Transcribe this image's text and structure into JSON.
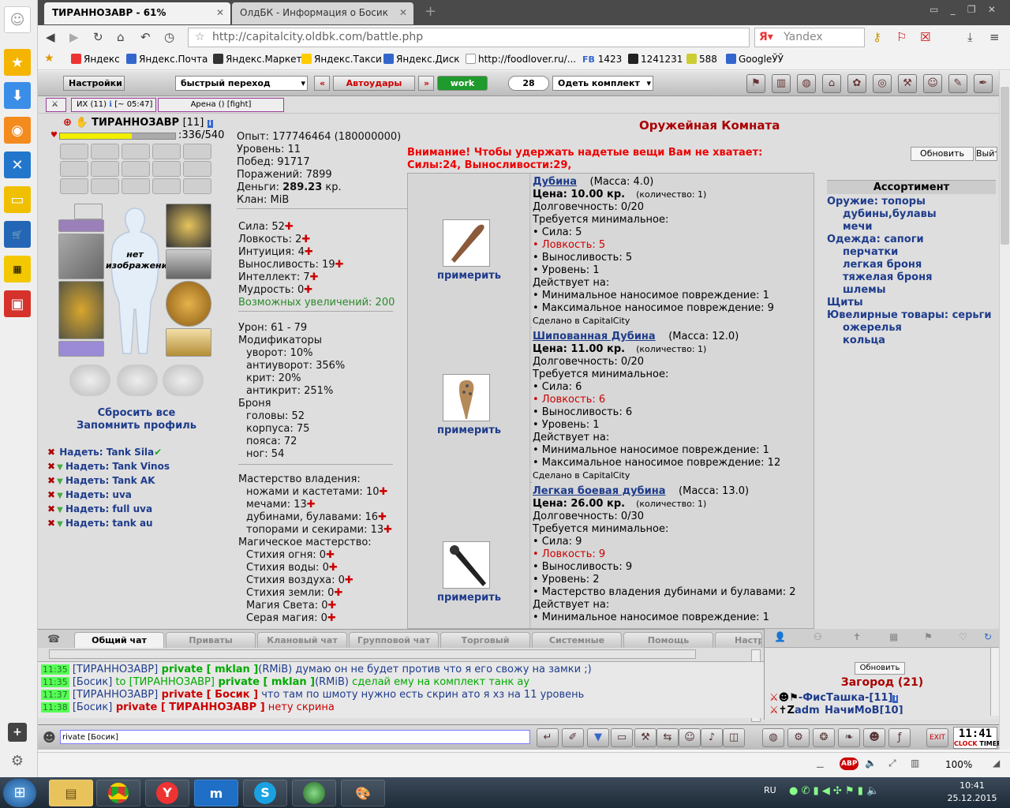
{
  "browser": {
    "tabs": [
      {
        "label": "ТИРАННОЗАВР - 61%",
        "active": true
      },
      {
        "label": "ОлдБК - Информация о Босик",
        "active": false
      }
    ],
    "url": "http://capitalcity.oldbk.com/battle.php",
    "search_placeholder": "Yandex",
    "bookmarks": [
      {
        "label": "Яндекс",
        "color": "#e33"
      },
      {
        "label": "Яндекс.Почта",
        "color": "#36c"
      },
      {
        "label": "Яндекс.Маркет",
        "color": "#333"
      },
      {
        "label": "Яндекс.Такси",
        "color": "#fc0"
      },
      {
        "label": "Яндекс.Диск",
        "color": "#36c"
      },
      {
        "label": "http://foodlover.ru/...",
        "color": "#bbb"
      },
      {
        "label": "1423",
        "color": "#36c",
        "icon_text": "FB"
      },
      {
        "label": "1241231",
        "color": "#222"
      },
      {
        "label": "588",
        "color": "#cc3"
      },
      {
        "label": "GoogleЎЎ",
        "color": "#36c"
      }
    ],
    "zoom": "100%"
  },
  "game_top": {
    "settings": "Настройки",
    "quick_nav": "быстрый переход",
    "prev": "«",
    "autohits": "Автоудары",
    "next": "»",
    "work": "work",
    "count": "28",
    "dress_set": "Одеть комплект"
  },
  "status": {
    "ix": "ИХ (11)",
    "ix_time": "[~ 05:47]",
    "arena": "Арена () [fight]"
  },
  "character": {
    "name": "ТИРАННОЗАВР",
    "level": "[11]",
    "hp": ":336/540",
    "hp_fraction": 0.62,
    "no_image": "нет изображения",
    "reset_all": "Сбросить все",
    "remember_profile": "Запомнить профиль",
    "sets": [
      "Надеть: Tank Sila",
      "Надеть: Tank Vinos",
      "Надеть: Tank AK",
      "Надеть: uva",
      "Надеть: full uva",
      "Надеть: tank au"
    ]
  },
  "info": {
    "exp": "Опыт: 177746464 (180000000)",
    "level": "Уровень: 11",
    "wins": "Побед: 91717",
    "losses": "Поражений: 7899",
    "money_label": "Деньги: ",
    "money_value": "289.23",
    "money_unit": " кр.",
    "clan": "Клан: MiB"
  },
  "stats": {
    "sila": "Сила: 52",
    "lovk": "Ловкость: 2",
    "intu": "Интуиция: 4",
    "vynos": "Выносливость: 19",
    "intel": "Интеллект: 7",
    "mudr": "Мудрость: 0",
    "possible": "Возможных увеличений: 200"
  },
  "combat": {
    "damage": "Урон: 61 - 79",
    "mods_title": "Модификаторы",
    "dodge": "уворот:  10%",
    "antidodge": "антиуворот:  356%",
    "crit": "крит:  20%",
    "anticrit": "антикрит:  251%",
    "armor_title": "Броня",
    "head": "головы:  52",
    "body": "корпуса:  75",
    "belt": "пояса:  72",
    "legs": "ног:  54"
  },
  "mastery": {
    "title": "Мастерство владения:",
    "knives": "ножами и кастетами: 10",
    "swords": "мечами: 13",
    "clubs": "дубинами, булавами: 16",
    "axes": "топорами и секирами: 13",
    "magic_title": "Магическое мастерство:",
    "fire": "Стихия огня: 0",
    "water": "Стихия воды: 0",
    "air": "Стихия воздуха: 0",
    "earth": "Стихия земли: 0",
    "light": "Магия Света: 0",
    "gray": "Серая магия: 0"
  },
  "armory": {
    "title": "Оружейная Комната",
    "warning": "Внимание! Чтобы удержать надетые вещи Вам не хватает:",
    "warning2": "Силы:24, Выносливости:29,",
    "refresh": "Обновить",
    "exit": "Выйти",
    "try_on": "примерить",
    "items": [
      {
        "name": "Дубина",
        "mass": "(Масса: 4.0)",
        "price": "Цена: 10.00 кр.",
        "qty": "(количество: 1)",
        "durability": "Долговечность: 0/20",
        "req_title": "Требуется минимальное:",
        "req": [
          "• Сила: 5",
          "• Ловкость: 5",
          "• Выносливость: 5",
          "• Уровень: 1"
        ],
        "req_red_index": 1,
        "acts_title": "Действует на:",
        "acts": [
          "• Минимальное наносимое повреждение: 1",
          "• Максимальное наносимое повреждение: 9"
        ],
        "made": "Сделано в CapitalCity"
      },
      {
        "name": "Шипованная Дубина",
        "mass": "(Масса: 12.0)",
        "price": "Цена: 11.00 кр.",
        "qty": "(количество: 1)",
        "durability": "Долговечность: 0/20",
        "req_title": "Требуется минимальное:",
        "req": [
          "• Сила: 6",
          "• Ловкость: 6",
          "• Выносливость: 6",
          "• Уровень: 1"
        ],
        "req_red_index": 1,
        "acts_title": "Действует на:",
        "acts": [
          "• Минимальное наносимое повреждение: 1",
          "• Максимальное наносимое повреждение: 12"
        ],
        "made": "Сделано в CapitalCity"
      },
      {
        "name": "Легкая боевая дубина",
        "mass": "(Масса: 13.0)",
        "price": "Цена: 26.00 кр.",
        "qty": "(количество: 1)",
        "durability": "Долговечность: 0/30",
        "req_title": "Требуется минимальное:",
        "req": [
          "• Сила: 9",
          "• Ловкость: 9",
          "• Выносливость: 9",
          "• Уровень: 2",
          "• Мастерство владения дубинами и булавами: 2"
        ],
        "req_red_index": 1,
        "acts_title": "Действует на:",
        "acts": [
          "• Минимальное наносимое повреждение: 1"
        ],
        "made": ""
      }
    ]
  },
  "assortment": {
    "title": "Ассортимент",
    "weapons_label": "Оружие: ",
    "weapons": [
      "топоры",
      "дубины,булавы",
      "мечи"
    ],
    "clothes_label": "Одежда: ",
    "clothes": [
      "сапоги",
      "перчатки",
      "легкая броня",
      "тяжелая броня",
      "шлемы"
    ],
    "shields": "Щиты",
    "jewelry_label": "Ювелирные товары: ",
    "jewelry": [
      "серьги",
      "ожерелья",
      "кольца"
    ]
  },
  "chat": {
    "tabs": [
      "Общий чат",
      "Приваты",
      "Клановый чат",
      "Групповой чат",
      "Торговый",
      "Системные",
      "Помощь",
      "Настр"
    ],
    "messages": [
      {
        "time": "11:35",
        "parts": [
          [
            "[ТИРАННОЗАВР]",
            "#1e3c8c"
          ],
          [
            " private [ mklan ]",
            "#0a0"
          ],
          [
            "(RMiB)",
            "#1e3c8c"
          ],
          [
            " думаю он не будет против что я его свожу на замки ;)",
            "#1e3c8c"
          ]
        ]
      },
      {
        "time": "11:35",
        "parts": [
          [
            "[Босик]",
            "#1e3c8c"
          ],
          [
            " to ",
            "#0a0"
          ],
          [
            "[ТИРАННОЗАВР]",
            "#0a0"
          ],
          [
            " private [ mklan ]",
            "#0a0"
          ],
          [
            "(RMiB)",
            "#1e3c8c"
          ],
          [
            " сделай ему на комплект танк ау",
            "#0a0"
          ]
        ]
      },
      {
        "time": "11:37",
        "parts": [
          [
            "[ТИРАННОЗАВР]",
            "#1e3c8c"
          ],
          [
            " private [ Босик ]",
            "#c00"
          ],
          [
            " что там по шмоту нужно есть скрин ато я хз на 11 уровень",
            "#1e3c8c"
          ]
        ]
      },
      {
        "time": "11:38",
        "parts": [
          [
            "[Босик]",
            "#1e3c8c"
          ],
          [
            " private [ ТИРАННОЗАВР ]",
            "#c00"
          ],
          [
            " нету скрина",
            "#c00"
          ]
        ]
      }
    ],
    "input_value": "rivate [Босик]",
    "online_refresh": "Обновить",
    "location": "Загород (21)",
    "online": [
      "-ФисТашка-[11]",
      "adm_НачиМоВ[10]"
    ]
  },
  "clock": {
    "label": "CLOCK",
    "timer": "TIMER",
    "time": "11:41"
  },
  "taskbar": {
    "lang": "RU",
    "time": "10:41",
    "date": "25.12.2015"
  }
}
